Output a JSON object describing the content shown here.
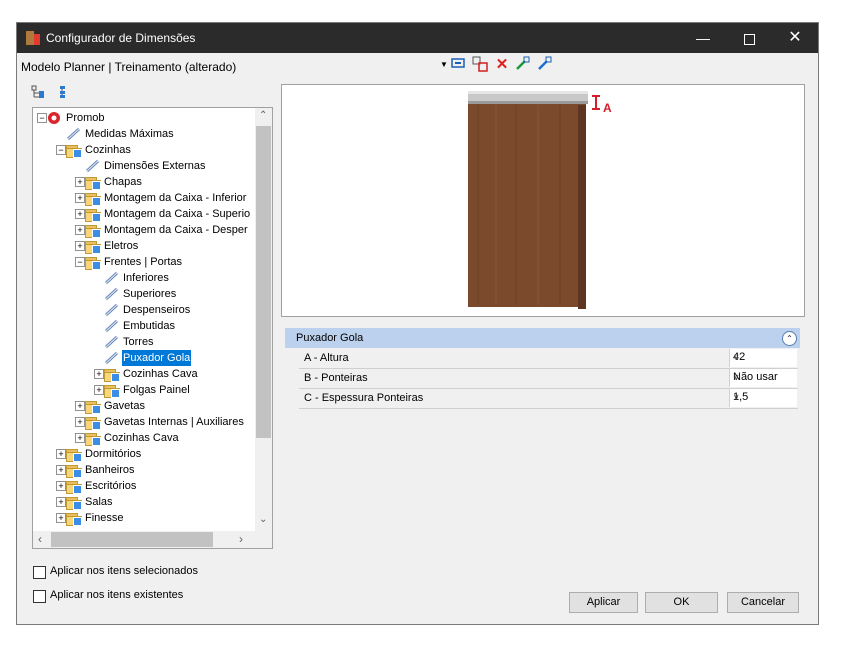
{
  "window": {
    "title": "Configurador de Dimensões"
  },
  "model_title": "Modelo Planner | Treinamento (alterado)",
  "tree": {
    "items": [
      {
        "label": "Promob",
        "level": 0,
        "icon": "promob-logo-icon",
        "expander": "minus"
      },
      {
        "label": "Medidas Máximas",
        "level": 1,
        "icon": "pencil-icon",
        "expander": "none"
      },
      {
        "label": "Cozinhas",
        "level": 1,
        "icon": "folder-icon",
        "expander": "minus"
      },
      {
        "label": "Dimensões Externas",
        "level": 2,
        "icon": "pencil-icon",
        "expander": "none"
      },
      {
        "label": "Chapas",
        "level": 2,
        "icon": "folder-icon",
        "expander": "plus"
      },
      {
        "label": "Montagem da Caixa - Inferior",
        "level": 2,
        "icon": "folder-icon",
        "expander": "plus"
      },
      {
        "label": "Montagem da Caixa - Superio",
        "level": 2,
        "icon": "folder-icon",
        "expander": "plus"
      },
      {
        "label": "Montagem da Caixa - Desper",
        "level": 2,
        "icon": "folder-icon",
        "expander": "plus"
      },
      {
        "label": "Eletros",
        "level": 2,
        "icon": "folder-icon",
        "expander": "plus"
      },
      {
        "label": "Frentes | Portas",
        "level": 2,
        "icon": "folder-icon",
        "expander": "minus"
      },
      {
        "label": "Inferiores",
        "level": 3,
        "icon": "pencil-icon",
        "expander": "none"
      },
      {
        "label": "Superiores",
        "level": 3,
        "icon": "pencil-icon",
        "expander": "none"
      },
      {
        "label": "Despenseiros",
        "level": 3,
        "icon": "pencil-icon",
        "expander": "none"
      },
      {
        "label": "Embutidas",
        "level": 3,
        "icon": "pencil-icon",
        "expander": "none"
      },
      {
        "label": "Torres",
        "level": 3,
        "icon": "pencil-icon",
        "expander": "none"
      },
      {
        "label": "Puxador Gola",
        "level": 3,
        "icon": "pencil-icon",
        "expander": "none",
        "selected": true
      },
      {
        "label": "Cozinhas Cava",
        "level": 3,
        "icon": "folder-icon",
        "expander": "plus"
      },
      {
        "label": "Folgas Painel",
        "level": 3,
        "icon": "folder-icon",
        "expander": "plus"
      },
      {
        "label": "Gavetas",
        "level": 2,
        "icon": "folder-icon",
        "expander": "plus"
      },
      {
        "label": "Gavetas Internas | Auxiliares",
        "level": 2,
        "icon": "folder-icon",
        "expander": "plus"
      },
      {
        "label": "Cozinhas Cava",
        "level": 2,
        "icon": "folder-icon",
        "expander": "plus"
      },
      {
        "label": "Dormitórios",
        "level": 1,
        "icon": "folder-icon",
        "expander": "plus"
      },
      {
        "label": "Banheiros",
        "level": 1,
        "icon": "folder-icon",
        "expander": "plus"
      },
      {
        "label": "Escritórios",
        "level": 1,
        "icon": "folder-icon",
        "expander": "plus"
      },
      {
        "label": "Salas",
        "level": 1,
        "icon": "folder-icon",
        "expander": "plus"
      },
      {
        "label": "Finesse",
        "level": 1,
        "icon": "folder-icon",
        "expander": "plus"
      }
    ]
  },
  "preview": {
    "dimension_label": "A",
    "door_color": "#7b4a2d",
    "handle_color": "#c8c8c8",
    "marker_color": "#d0202a"
  },
  "properties": {
    "section_title": "Puxador Gola",
    "rows": [
      {
        "name": "A - Altura",
        "value": "42"
      },
      {
        "name": "B - Ponteiras",
        "value": "Não usar"
      },
      {
        "name": "C - Espessura Ponteiras",
        "value": "1,5"
      }
    ]
  },
  "options": {
    "apply_selected": "Aplicar nos itens selecionados",
    "apply_existing": "Aplicar nos itens existentes"
  },
  "buttons": {
    "apply": "Aplicar",
    "ok": "OK",
    "cancel": "Cancelar"
  }
}
